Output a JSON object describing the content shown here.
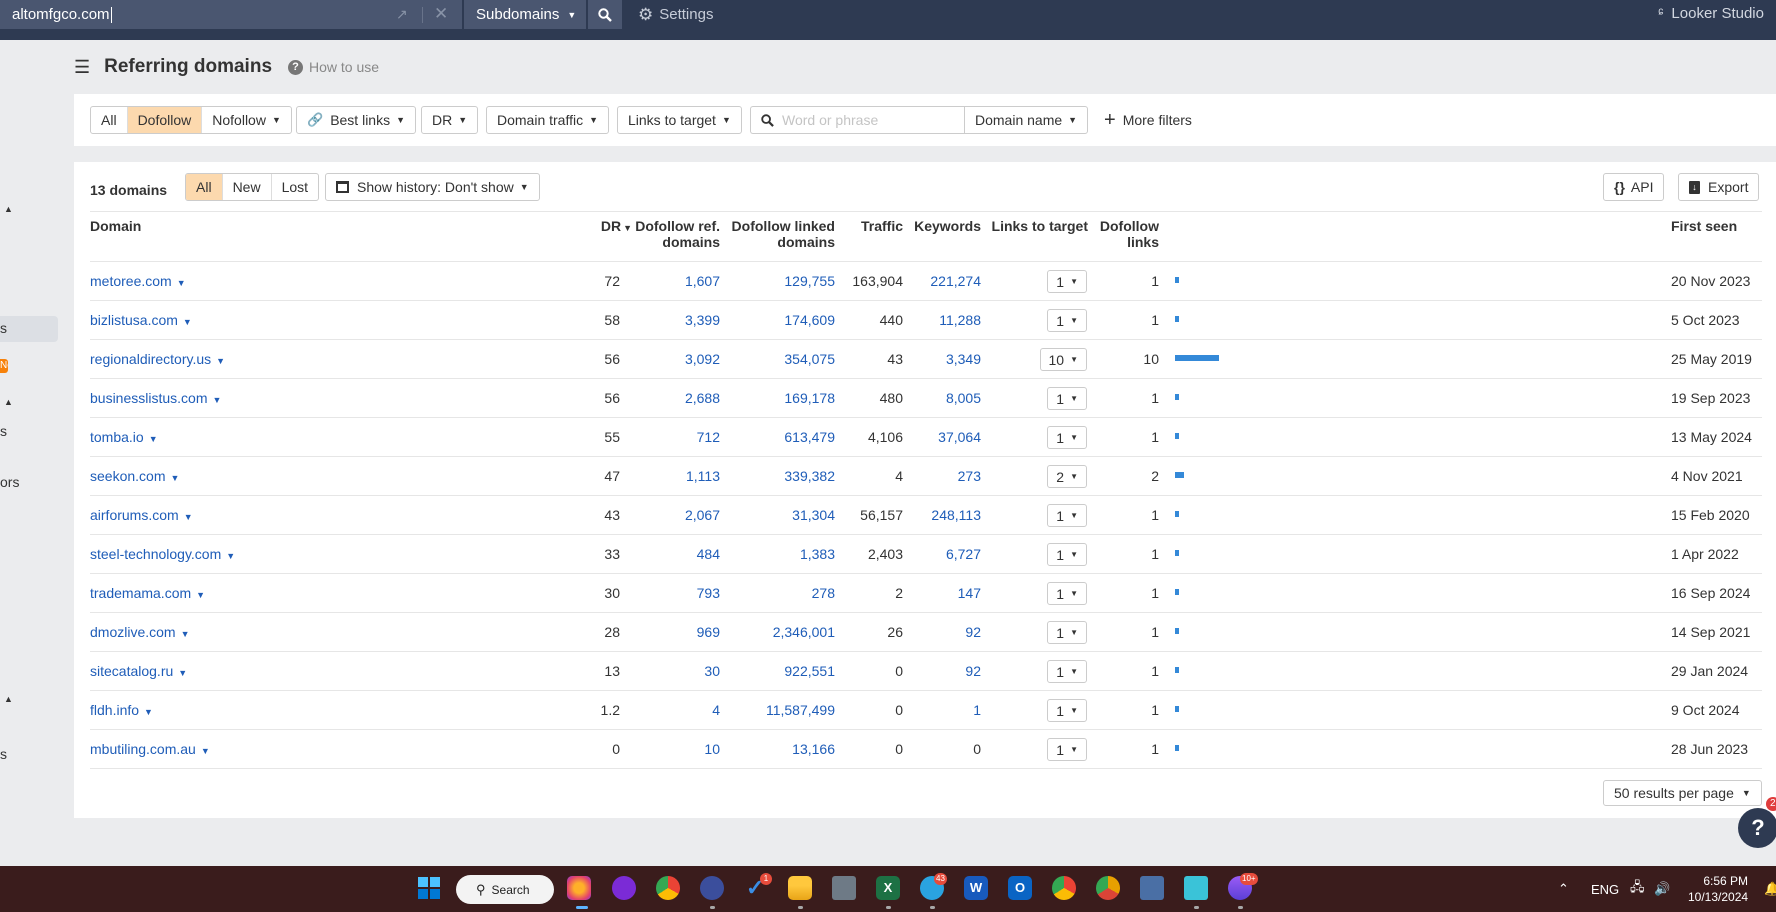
{
  "topbar": {
    "search_value": "altomfgco.com",
    "mode_label": "Subdomains",
    "settings_label": "Settings",
    "looker_label": "Looker Studio"
  },
  "sidebar": {
    "fragments": [
      "s",
      "s",
      "ors",
      "s"
    ],
    "new_badge": "New"
  },
  "header": {
    "title": "Referring domains",
    "how_to_use": "How to use"
  },
  "filters": {
    "link_type": [
      "All",
      "Dofollow",
      "Nofollow"
    ],
    "link_type_selected": "Dofollow",
    "best_links": "Best links",
    "dr": "DR",
    "domain_traffic": "Domain traffic",
    "links_to_target": "Links to target",
    "search_placeholder": "Word or phrase",
    "search_value": "",
    "search_scope": "Domain name",
    "more_filters": "More filters"
  },
  "summary": {
    "count_label": "13 domains",
    "tabs": [
      "All",
      "New",
      "Lost"
    ],
    "active_tab": "All",
    "history_label": "Show history: Don't show",
    "api_label": "API",
    "export_label": "Export"
  },
  "table": {
    "columns": {
      "domain": "Domain",
      "dr": "DR",
      "dofollow_ref_domains": [
        "Dofollow ref.",
        "domains"
      ],
      "dofollow_linked_domains": [
        "Dofollow linked",
        "domains"
      ],
      "traffic": "Traffic",
      "keywords": "Keywords",
      "links_to_target": "Links to target",
      "dofollow_links": [
        "Dofollow",
        "links"
      ],
      "first_seen": "First seen"
    },
    "sort": {
      "column": "DR",
      "direction": "desc"
    },
    "rows": [
      {
        "domain": "metoree.com",
        "dr": "72",
        "ref_domains": "1,607",
        "linked_domains": "129,755",
        "traffic": "163,904",
        "keywords": "221,274",
        "links_to_target": "1",
        "dofollow_links": "1",
        "dofollow_links_value": 1,
        "first_seen": "20 Nov 2023"
      },
      {
        "domain": "bizlistusa.com",
        "dr": "58",
        "ref_domains": "3,399",
        "linked_domains": "174,609",
        "traffic": "440",
        "keywords": "11,288",
        "links_to_target": "1",
        "dofollow_links": "1",
        "dofollow_links_value": 1,
        "first_seen": "5 Oct 2023"
      },
      {
        "domain": "regionaldirectory.us",
        "dr": "56",
        "ref_domains": "3,092",
        "linked_domains": "354,075",
        "traffic": "43",
        "keywords": "3,349",
        "links_to_target": "10",
        "dofollow_links": "10",
        "dofollow_links_value": 10,
        "first_seen": "25 May 2019"
      },
      {
        "domain": "businesslistus.com",
        "dr": "56",
        "ref_domains": "2,688",
        "linked_domains": "169,178",
        "traffic": "480",
        "keywords": "8,005",
        "links_to_target": "1",
        "dofollow_links": "1",
        "dofollow_links_value": 1,
        "first_seen": "19 Sep 2023"
      },
      {
        "domain": "tomba.io",
        "dr": "55",
        "ref_domains": "712",
        "linked_domains": "613,479",
        "traffic": "4,106",
        "keywords": "37,064",
        "links_to_target": "1",
        "dofollow_links": "1",
        "dofollow_links_value": 1,
        "first_seen": "13 May 2024"
      },
      {
        "domain": "seekon.com",
        "dr": "47",
        "ref_domains": "1,113",
        "linked_domains": "339,382",
        "traffic": "4",
        "keywords": "273",
        "links_to_target": "2",
        "dofollow_links": "2",
        "dofollow_links_value": 2,
        "first_seen": "4 Nov 2021"
      },
      {
        "domain": "airforums.com",
        "dr": "43",
        "ref_domains": "2,067",
        "linked_domains": "31,304",
        "traffic": "56,157",
        "keywords": "248,113",
        "links_to_target": "1",
        "dofollow_links": "1",
        "dofollow_links_value": 1,
        "first_seen": "15 Feb 2020"
      },
      {
        "domain": "steel-technology.com",
        "dr": "33",
        "ref_domains": "484",
        "linked_domains": "1,383",
        "traffic": "2,403",
        "keywords": "6,727",
        "links_to_target": "1",
        "dofollow_links": "1",
        "dofollow_links_value": 1,
        "first_seen": "1 Apr 2022"
      },
      {
        "domain": "trademama.com",
        "dr": "30",
        "ref_domains": "793",
        "linked_domains": "278",
        "traffic": "2",
        "keywords": "147",
        "links_to_target": "1",
        "dofollow_links": "1",
        "dofollow_links_value": 1,
        "first_seen": "16 Sep 2024"
      },
      {
        "domain": "dmozlive.com",
        "dr": "28",
        "ref_domains": "969",
        "linked_domains": "2,346,001",
        "traffic": "26",
        "keywords": "92",
        "links_to_target": "1",
        "dofollow_links": "1",
        "dofollow_links_value": 1,
        "first_seen": "14 Sep 2021"
      },
      {
        "domain": "sitecatalog.ru",
        "dr": "13",
        "ref_domains": "30",
        "linked_domains": "922,551",
        "traffic": "0",
        "keywords": "92",
        "links_to_target": "1",
        "dofollow_links": "1",
        "dofollow_links_value": 1,
        "first_seen": "29 Jan 2024"
      },
      {
        "domain": "fldh.info",
        "dr": "1.2",
        "ref_domains": "4",
        "linked_domains": "11,587,499",
        "traffic": "0",
        "keywords": "1",
        "links_to_target": "1",
        "dofollow_links": "1",
        "dofollow_links_value": 1,
        "first_seen": "9 Oct 2024"
      },
      {
        "domain": "mbutiling.com.au",
        "dr": "0",
        "ref_domains": "10",
        "linked_domains": "13,166",
        "traffic": "0",
        "keywords": "0",
        "links_to_target": "1",
        "dofollow_links": "1",
        "dofollow_links_value": 1,
        "first_seen": "28 Jun 2023"
      }
    ]
  },
  "pagination": {
    "per_page_label": "50 results per page"
  },
  "help": {
    "label": "?",
    "badge": "2"
  },
  "taskbar": {
    "search_label": "Search",
    "apps": [
      "windows-start",
      "search",
      "firefox",
      "ai-assistant",
      "chrome-profile",
      "react-devtools",
      "todo",
      "file-explorer",
      "calculator",
      "excel",
      "telegram",
      "word",
      "outlook",
      "chrome-profile-2",
      "chrome-canary",
      "remote-desktop",
      "notepad",
      "messenger"
    ],
    "badges": {
      "todo": "1",
      "telegram": "43",
      "messenger": "10+"
    },
    "tray_lang": "ENG",
    "time": "6:56 PM",
    "date": "10/13/2024"
  },
  "colors": {
    "topbar": "#2e3a52",
    "accent_selected": "#fcd9ae",
    "link": "#1f5db8",
    "bar": "#3489d8"
  }
}
